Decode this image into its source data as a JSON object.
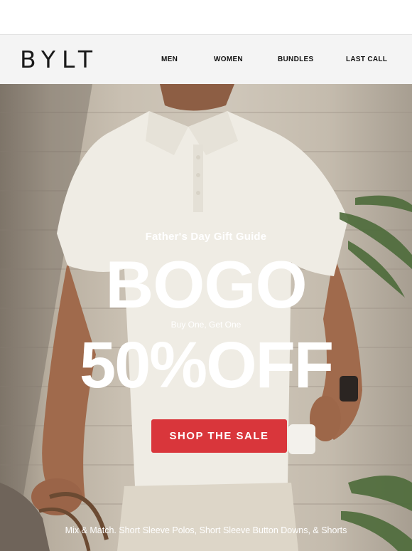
{
  "brand": {
    "logo_text": "BYLT"
  },
  "nav": {
    "items": [
      {
        "label": "MEN"
      },
      {
        "label": "WOMEN"
      },
      {
        "label": "BUNDLES"
      },
      {
        "label": "LAST CALL"
      }
    ]
  },
  "hero": {
    "eyebrow": "Father's Day Gift Guide",
    "headline": "BOGO",
    "headline_sub": "Buy One, Get One",
    "discount": "50%OFF",
    "cta_label": "SHOP THE SALE",
    "footnote": "Mix & Match. Short Sleeve Polos, Short Sleeve Button Downs, & Shorts"
  },
  "colors": {
    "cta_background": "#d9363b",
    "nav_background": "#f4f4f4",
    "text_light": "#ffffff"
  }
}
